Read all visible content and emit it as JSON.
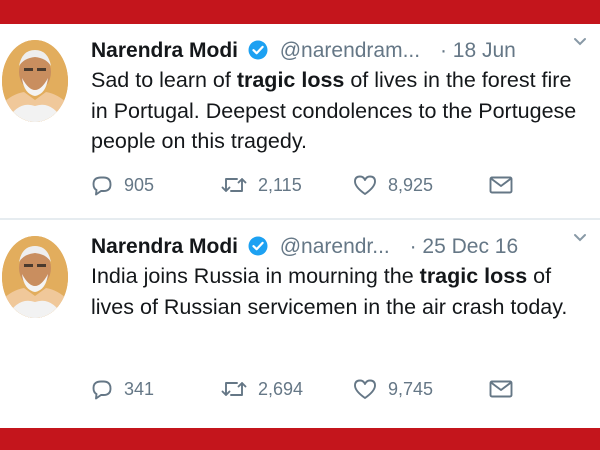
{
  "colors": {
    "accent_red": "#c4151c",
    "verified_blue": "#1da1f2",
    "muted": "#657786",
    "text": "#14171a"
  },
  "tweets": [
    {
      "name": "Narendra Modi",
      "handle": "@narendram...",
      "date": "· 18 Jun",
      "text_1": "Sad to learn of ",
      "bold": "tragic loss",
      "text_2": " of lives in the forest fire in Portugal. Deepest condolences to the Portugese people on this tragedy.",
      "replies": "905",
      "retweets": "2,115",
      "likes": "8,925"
    },
    {
      "name": "Narendra Modi",
      "handle": "@narendr...",
      "date": "· 25 Dec 16",
      "text_1": "India joins Russia in mourning the ",
      "bold": "tragic loss",
      "text_2": " of lives of Russian servicemen in the air crash today.",
      "replies": "341",
      "retweets": "2,694",
      "likes": "9,745"
    }
  ],
  "icons": [
    "verified-icon",
    "chevron-down-icon",
    "reply-icon",
    "retweet-icon",
    "like-icon",
    "direct-message-icon"
  ]
}
